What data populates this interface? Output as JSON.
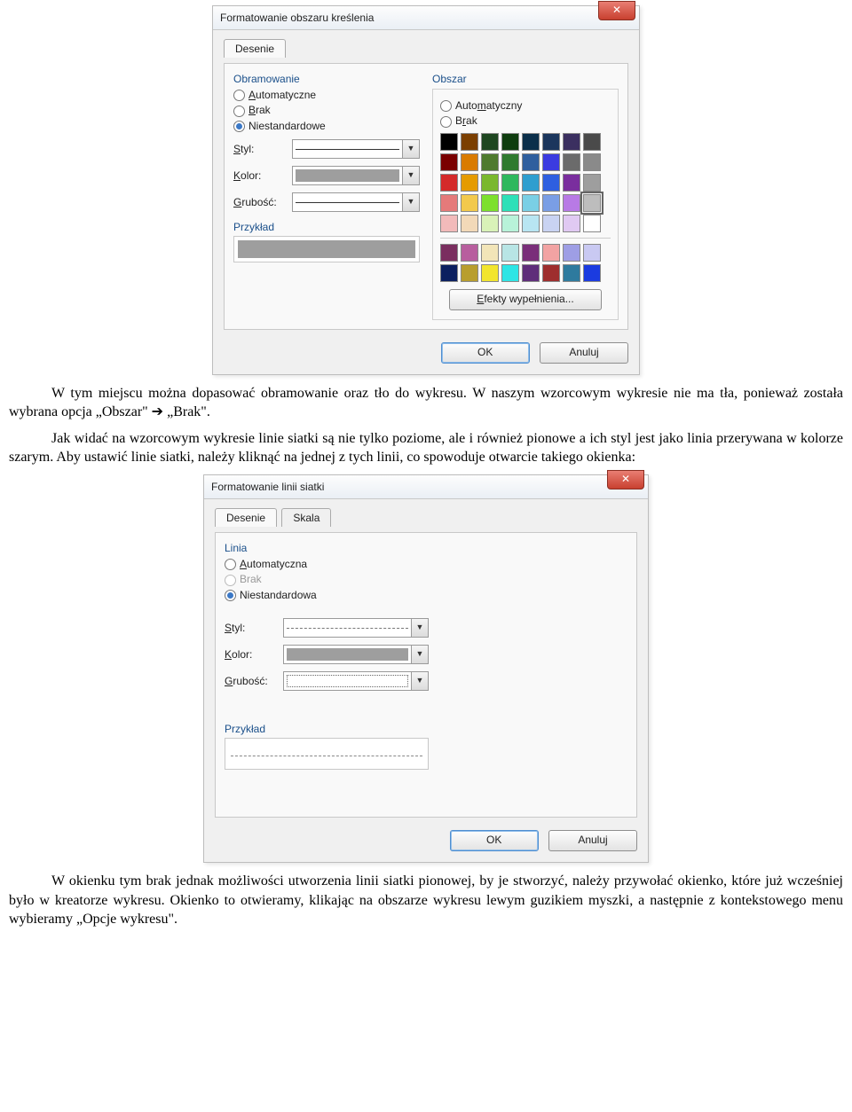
{
  "dialog1": {
    "title": "Formatowanie obszaru kreślenia",
    "tab": "Desenie",
    "border_title": "Obramowanie",
    "area_title": "Obszar",
    "border_auto": "Automatyczne",
    "border_none": "Brak",
    "border_custom": "Niestandardowe",
    "area_auto": "Automatyczny",
    "area_none": "Brak",
    "lbl_style": "Styl:",
    "lbl_color": "Kolor:",
    "lbl_width": "Grubość:",
    "example_label": "Przykład",
    "effects_btn": "Efekty wypełnienia...",
    "ok": "OK",
    "cancel": "Anuluj",
    "palette": [
      [
        "#000000",
        "#7b3f00",
        "#1e4620",
        "#0f3d0f",
        "#0b2f4a",
        "#1b365d",
        "#3b2f60",
        "#4a4a4a"
      ],
      [
        "#7a0000",
        "#d97b00",
        "#4f7a2e",
        "#2f7a2f",
        "#2f5f9e",
        "#3b3be0",
        "#6b6b6b",
        "#8a8a8a"
      ],
      [
        "#d42a2a",
        "#e59b00",
        "#7ab82e",
        "#2eb85e",
        "#2e9ecf",
        "#2e5fe0",
        "#7a2e9e",
        "#9e9e9e"
      ],
      [
        "#e57a7a",
        "#f2c94c",
        "#7de02e",
        "#2ee0b8",
        "#7acfe5",
        "#7a9ee5",
        "#b87ae5",
        "#bdbdbd"
      ],
      [
        "#f2baba",
        "#f2d9b8",
        "#d9f2b8",
        "#b8f2d9",
        "#b8e5f2",
        "#c9d3f2",
        "#e0c9f2",
        "#ffffff"
      ]
    ],
    "palette2": [
      [
        "#7a2e5f",
        "#b85e9e",
        "#f2e5b8",
        "#b8e5e5",
        "#7a2e7a",
        "#f2a3a3",
        "#9e9ee5",
        "#c9c9f2"
      ],
      [
        "#0b1f5f",
        "#b89e2e",
        "#f2e52e",
        "#2ee5e5",
        "#5f2e7a",
        "#9e2e2e",
        "#2e7a9e",
        "#1b3be0"
      ]
    ]
  },
  "para1": "W tym miejscu można dopasować obramowanie oraz tło do wykresu. W naszym wzorcowym wykresie nie ma tła, ponieważ została wybrana opcja „Obszar\" ➔ „Brak\".",
  "para2": "Jak widać na wzorcowym wykresie linie siatki są nie tylko poziome, ale i również pionowe a ich styl jest jako linia przerywana w kolorze szarym. Aby ustawić linie siatki, należy kliknąć na jednej z tych linii, co spowoduje otwarcie takiego okienka:",
  "dialog2": {
    "title": "Formatowanie linii siatki",
    "tab1": "Desenie",
    "tab2": "Skala",
    "line_title": "Linia",
    "line_auto": "Automatyczna",
    "line_none": "Brak",
    "line_custom": "Niestandardowa",
    "lbl_style": "Styl:",
    "lbl_color": "Kolor:",
    "lbl_width": "Grubość:",
    "example_label": "Przykład",
    "ok": "OK",
    "cancel": "Anuluj"
  },
  "para3": "W okienku tym brak jednak możliwości utworzenia linii siatki pionowej, by je stworzyć, należy przywołać okienko, które już wcześniej było w kreatorze wykresu. Okienko to otwieramy, klikając na obszarze wykresu lewym guzikiem myszki, a następnie z kontekstowego menu wybieramy „Opcje wykresu\"."
}
